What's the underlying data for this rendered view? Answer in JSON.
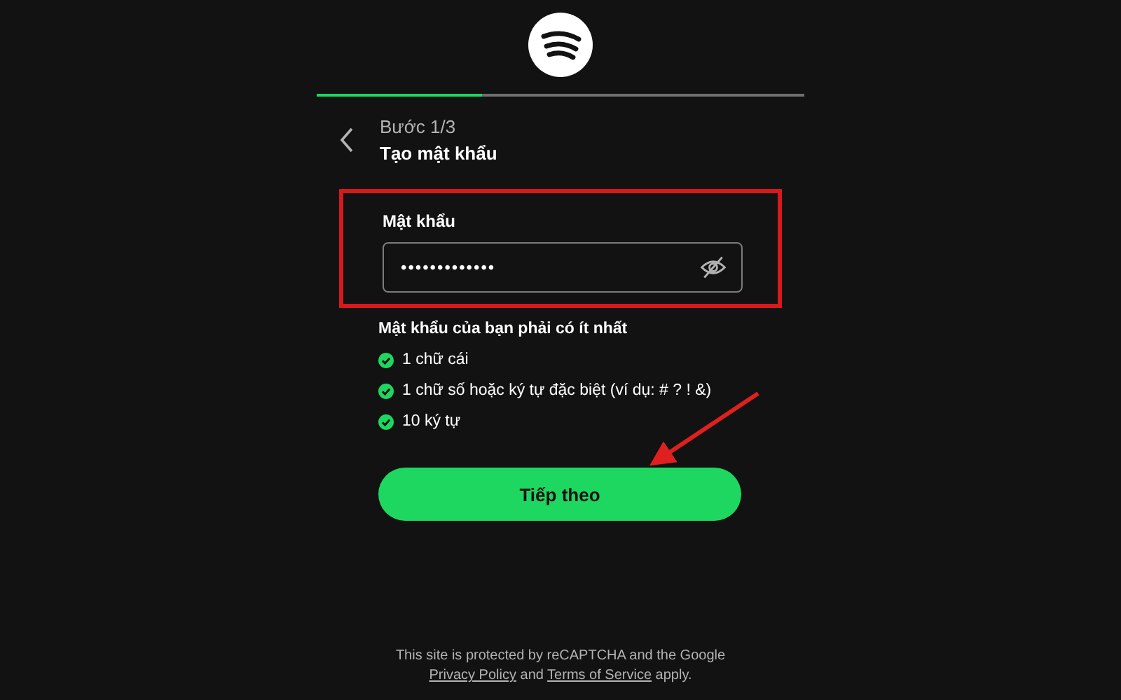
{
  "progress": {
    "level": 0.34
  },
  "header": {
    "step": "Bước 1/3",
    "title": "Tạo mật khẩu"
  },
  "password_field": {
    "label": "Mật khẩu",
    "value": "•••••••••••••",
    "highlighted": true
  },
  "requirements": {
    "title": "Mật khẩu của bạn phải có ít nhất",
    "items": [
      {
        "text": "1 chữ cái",
        "met": true
      },
      {
        "text": "1 chữ số hoặc ký tự đặc biệt (ví dụ: # ? ! &)",
        "met": true
      },
      {
        "text": "10 ký tự",
        "met": true
      }
    ]
  },
  "next_button": {
    "label": "Tiếp theo"
  },
  "footer": {
    "line": "This site is protected by reCAPTCHA and the Google",
    "privacy": "Privacy Policy",
    "joiner": "and",
    "terms": "Terms of Service",
    "end": "apply."
  }
}
